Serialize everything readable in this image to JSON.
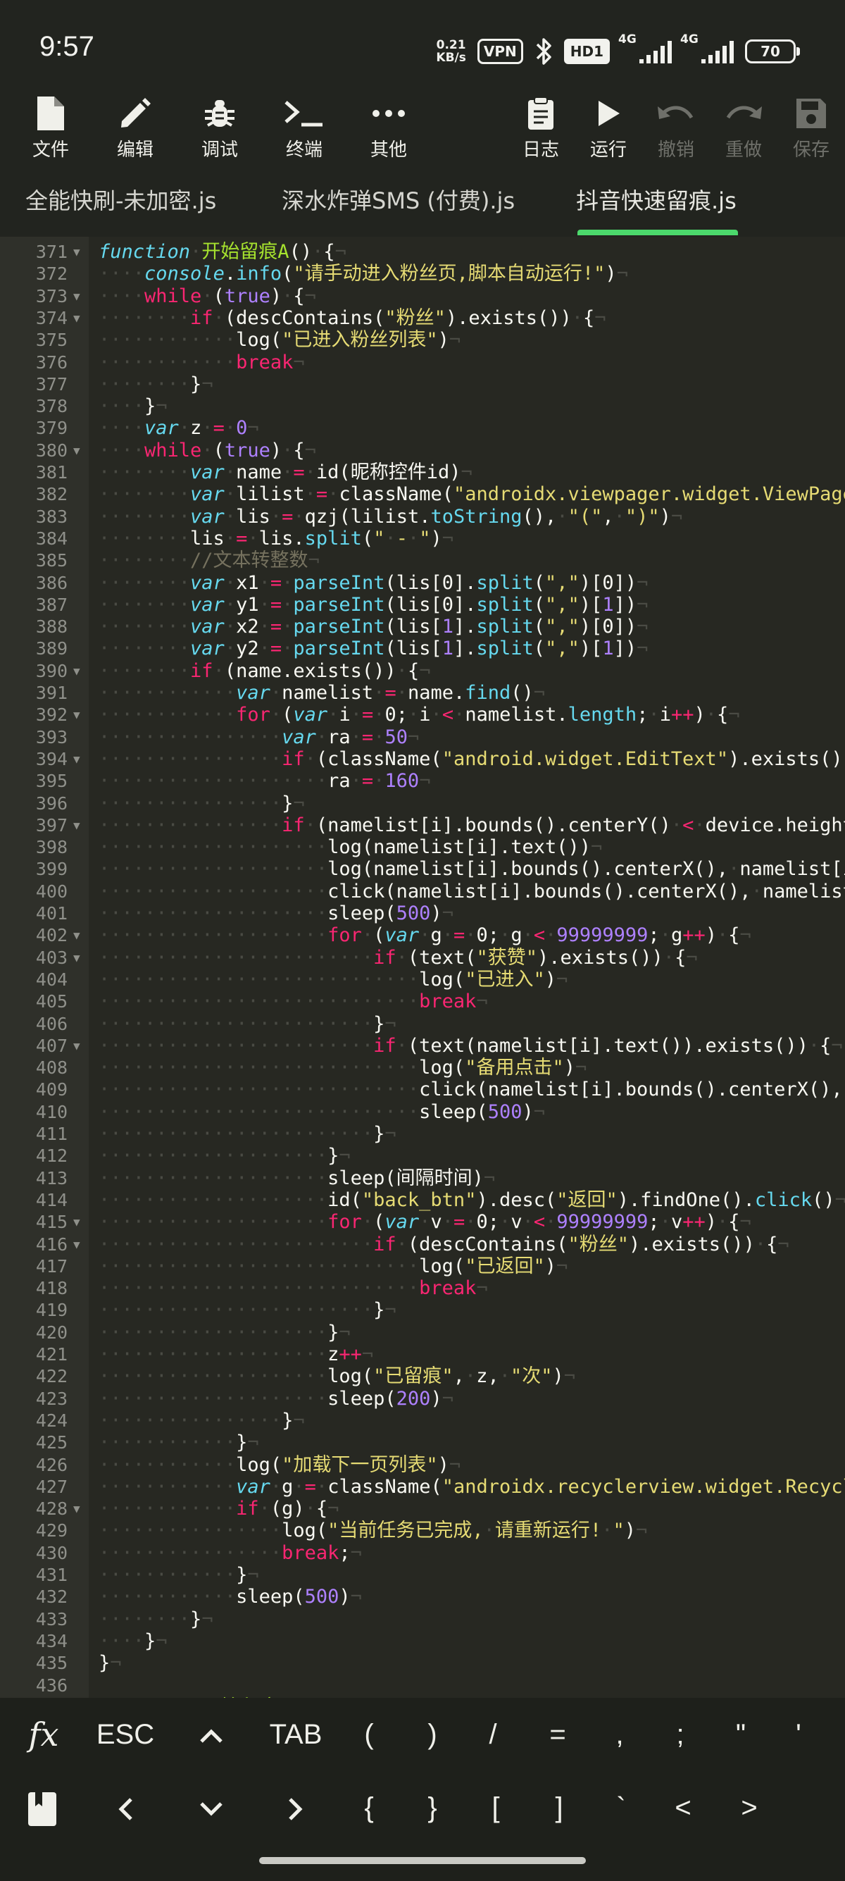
{
  "status": {
    "time": "9:57",
    "net_speed_value": "0.21",
    "net_speed_unit": "KB/s",
    "vpn": "VPN",
    "hd": "HD1",
    "net1": "4G",
    "net2": "4G",
    "battery": "70"
  },
  "toolbar": {
    "file": "文件",
    "edit": "编辑",
    "debug": "调试",
    "terminal": "终端",
    "more": "其他",
    "log": "日志",
    "run": "运行",
    "undo": "撤销",
    "redo": "重做",
    "save": "保存"
  },
  "tabs": [
    {
      "label": "全能快刷-未加密.js"
    },
    {
      "label": "深水炸弹SMS (付费).js"
    },
    {
      "label": "抖音快速留痕.js"
    }
  ],
  "code_lines": [
    {
      "n": "371",
      "fold": true,
      "i": 0,
      "t": [
        [
          "it",
          "function"
        ],
        [
          "p",
          " "
        ],
        [
          "fn",
          "开始留痕A"
        ],
        [
          "p",
          "() {"
        ]
      ]
    },
    {
      "n": "372",
      "i": 1,
      "t": [
        [
          "it",
          "console"
        ],
        [
          "p",
          "."
        ],
        [
          "bi",
          "info"
        ],
        [
          "p",
          "("
        ],
        [
          "st",
          "\"请手动进入粉丝页,脚本自动运行!\""
        ],
        [
          "p",
          ")"
        ]
      ]
    },
    {
      "n": "373",
      "fold": true,
      "i": 1,
      "t": [
        [
          "kw",
          "while"
        ],
        [
          "p",
          " ("
        ],
        [
          "nu",
          "true"
        ],
        [
          "p",
          ") {"
        ]
      ]
    },
    {
      "n": "374",
      "fold": true,
      "i": 2,
      "t": [
        [
          "kw",
          "if"
        ],
        [
          "p",
          " (descContains("
        ],
        [
          "st",
          "\"粉丝\""
        ],
        [
          "p",
          ").exists()) {"
        ]
      ]
    },
    {
      "n": "375",
      "i": 3,
      "t": [
        [
          "p",
          "log("
        ],
        [
          "st",
          "\"已进入粉丝列表\""
        ],
        [
          "p",
          ")"
        ]
      ]
    },
    {
      "n": "376",
      "i": 3,
      "t": [
        [
          "kw",
          "break"
        ]
      ]
    },
    {
      "n": "377",
      "i": 2,
      "t": [
        [
          "p",
          "}"
        ]
      ]
    },
    {
      "n": "378",
      "i": 1,
      "t": [
        [
          "p",
          "}"
        ]
      ]
    },
    {
      "n": "379",
      "i": 1,
      "t": [
        [
          "it",
          "var"
        ],
        [
          "p",
          " z "
        ],
        [
          "kw",
          "="
        ],
        [
          "p",
          " "
        ],
        [
          "nu",
          "0"
        ]
      ]
    },
    {
      "n": "380",
      "fold": true,
      "i": 1,
      "t": [
        [
          "kw",
          "while"
        ],
        [
          "p",
          " ("
        ],
        [
          "nu",
          "true"
        ],
        [
          "p",
          ") {"
        ]
      ]
    },
    {
      "n": "381",
      "i": 2,
      "t": [
        [
          "it",
          "var"
        ],
        [
          "p",
          " name "
        ],
        [
          "kw",
          "="
        ],
        [
          "p",
          " id(昵称控件id)"
        ]
      ]
    },
    {
      "n": "382",
      "i": 2,
      "t": [
        [
          "it",
          "var"
        ],
        [
          "p",
          " lilist "
        ],
        [
          "kw",
          "="
        ],
        [
          "p",
          " className("
        ],
        [
          "st",
          "\"androidx.viewpager.widget.ViewPager\""
        ],
        [
          "p",
          ")"
        ]
      ]
    },
    {
      "n": "383",
      "i": 2,
      "t": [
        [
          "it",
          "var"
        ],
        [
          "p",
          " lis "
        ],
        [
          "kw",
          "="
        ],
        [
          "p",
          " qzj(lilist."
        ],
        [
          "bi",
          "toString"
        ],
        [
          "p",
          "(), "
        ],
        [
          "st",
          "\"(\""
        ],
        [
          "p",
          ", "
        ],
        [
          "st",
          "\")\""
        ],
        [
          "p",
          ")"
        ]
      ]
    },
    {
      "n": "384",
      "i": 2,
      "t": [
        [
          "p",
          "lis "
        ],
        [
          "kw",
          "="
        ],
        [
          "p",
          " lis."
        ],
        [
          "bi",
          "split"
        ],
        [
          "p",
          "("
        ],
        [
          "st",
          "\" - \""
        ],
        [
          "p",
          ")"
        ]
      ]
    },
    {
      "n": "385",
      "i": 2,
      "t": [
        [
          "cm",
          "//文本转整数"
        ]
      ]
    },
    {
      "n": "386",
      "i": 2,
      "t": [
        [
          "it",
          "var"
        ],
        [
          "p",
          " x1 "
        ],
        [
          "kw",
          "="
        ],
        [
          "p",
          " "
        ],
        [
          "bi",
          "parseInt"
        ],
        [
          "p",
          "(lis[0]."
        ],
        [
          "bi",
          "split"
        ],
        [
          "p",
          "("
        ],
        [
          "st",
          "\",\""
        ],
        [
          "p",
          ")[0])"
        ]
      ]
    },
    {
      "n": "387",
      "i": 2,
      "t": [
        [
          "it",
          "var"
        ],
        [
          "p",
          " y1 "
        ],
        [
          "kw",
          "="
        ],
        [
          "p",
          " "
        ],
        [
          "bi",
          "parseInt"
        ],
        [
          "p",
          "(lis[0]."
        ],
        [
          "bi",
          "split"
        ],
        [
          "p",
          "("
        ],
        [
          "st",
          "\",\""
        ],
        [
          "p",
          ")["
        ],
        [
          "nu",
          "1"
        ],
        [
          "p",
          "])"
        ]
      ]
    },
    {
      "n": "388",
      "i": 2,
      "t": [
        [
          "it",
          "var"
        ],
        [
          "p",
          " x2 "
        ],
        [
          "kw",
          "="
        ],
        [
          "p",
          " "
        ],
        [
          "bi",
          "parseInt"
        ],
        [
          "p",
          "(lis["
        ],
        [
          "nu",
          "1"
        ],
        [
          "p",
          "]."
        ],
        [
          "bi",
          "split"
        ],
        [
          "p",
          "("
        ],
        [
          "st",
          "\",\""
        ],
        [
          "p",
          ")[0])"
        ]
      ]
    },
    {
      "n": "389",
      "i": 2,
      "t": [
        [
          "it",
          "var"
        ],
        [
          "p",
          " y2 "
        ],
        [
          "kw",
          "="
        ],
        [
          "p",
          " "
        ],
        [
          "bi",
          "parseInt"
        ],
        [
          "p",
          "(lis["
        ],
        [
          "nu",
          "1"
        ],
        [
          "p",
          "]."
        ],
        [
          "bi",
          "split"
        ],
        [
          "p",
          "("
        ],
        [
          "st",
          "\",\""
        ],
        [
          "p",
          ")["
        ],
        [
          "nu",
          "1"
        ],
        [
          "p",
          "])"
        ]
      ]
    },
    {
      "n": "390",
      "fold": true,
      "i": 2,
      "t": [
        [
          "kw",
          "if"
        ],
        [
          "p",
          " (name.exists()) {"
        ]
      ]
    },
    {
      "n": "391",
      "i": 3,
      "t": [
        [
          "it",
          "var"
        ],
        [
          "p",
          " namelist "
        ],
        [
          "kw",
          "="
        ],
        [
          "p",
          " name."
        ],
        [
          "bi",
          "find"
        ],
        [
          "p",
          "()"
        ]
      ]
    },
    {
      "n": "392",
      "fold": true,
      "i": 3,
      "t": [
        [
          "kw",
          "for"
        ],
        [
          "p",
          " ("
        ],
        [
          "it",
          "var"
        ],
        [
          "p",
          " i "
        ],
        [
          "kw",
          "="
        ],
        [
          "p",
          " 0; i "
        ],
        [
          "kw",
          "<"
        ],
        [
          "p",
          " namelist."
        ],
        [
          "bi",
          "length"
        ],
        [
          "p",
          "; i"
        ],
        [
          "kw",
          "++"
        ],
        [
          "p",
          ") {"
        ]
      ]
    },
    {
      "n": "393",
      "i": 4,
      "t": [
        [
          "it",
          "var"
        ],
        [
          "p",
          " ra "
        ],
        [
          "kw",
          "="
        ],
        [
          "p",
          " "
        ],
        [
          "nu",
          "50"
        ]
      ]
    },
    {
      "n": "394",
      "fold": true,
      "i": 4,
      "t": [
        [
          "kw",
          "if"
        ],
        [
          "p",
          " (className("
        ],
        [
          "st",
          "\"android.widget.EditText\""
        ],
        [
          "p",
          ").exists()) {"
        ]
      ]
    },
    {
      "n": "395",
      "i": 5,
      "t": [
        [
          "p",
          "ra "
        ],
        [
          "kw",
          "="
        ],
        [
          "p",
          " "
        ],
        [
          "nu",
          "160"
        ]
      ]
    },
    {
      "n": "396",
      "i": 4,
      "t": [
        [
          "p",
          "}"
        ]
      ]
    },
    {
      "n": "397",
      "fold": true,
      "i": 4,
      "t": [
        [
          "kw",
          "if"
        ],
        [
          "p",
          " (namelist[i].bounds().centerY() "
        ],
        [
          "kw",
          "<"
        ],
        [
          "p",
          " device.height"
        ]
      ]
    },
    {
      "n": "398",
      "i": 5,
      "t": [
        [
          "p",
          "log(namelist[i].text())"
        ]
      ]
    },
    {
      "n": "399",
      "i": 5,
      "t": [
        [
          "p",
          "log(namelist[i].bounds().centerX(), namelist[i]"
        ]
      ]
    },
    {
      "n": "400",
      "i": 5,
      "t": [
        [
          "p",
          "click(namelist[i].bounds().centerX(), namelist["
        ]
      ]
    },
    {
      "n": "401",
      "i": 5,
      "t": [
        [
          "p",
          "sleep("
        ],
        [
          "nu",
          "500"
        ],
        [
          "p",
          ")"
        ]
      ]
    },
    {
      "n": "402",
      "fold": true,
      "i": 5,
      "t": [
        [
          "kw",
          "for"
        ],
        [
          "p",
          " ("
        ],
        [
          "it",
          "var"
        ],
        [
          "p",
          " g "
        ],
        [
          "kw",
          "="
        ],
        [
          "p",
          " 0; g "
        ],
        [
          "kw",
          "<"
        ],
        [
          "p",
          " "
        ],
        [
          "nu",
          "99999999"
        ],
        [
          "p",
          "; g"
        ],
        [
          "kw",
          "++"
        ],
        [
          "p",
          ") {"
        ]
      ]
    },
    {
      "n": "403",
      "fold": true,
      "i": 6,
      "t": [
        [
          "kw",
          "if"
        ],
        [
          "p",
          " (text("
        ],
        [
          "st",
          "\"获赞\""
        ],
        [
          "p",
          ").exists()) {"
        ]
      ]
    },
    {
      "n": "404",
      "i": 7,
      "t": [
        [
          "p",
          "log("
        ],
        [
          "st",
          "\"已进入\""
        ],
        [
          "p",
          ")"
        ]
      ]
    },
    {
      "n": "405",
      "i": 7,
      "t": [
        [
          "kw",
          "break"
        ]
      ]
    },
    {
      "n": "406",
      "i": 6,
      "t": [
        [
          "p",
          "}"
        ]
      ]
    },
    {
      "n": "407",
      "fold": true,
      "i": 6,
      "t": [
        [
          "kw",
          "if"
        ],
        [
          "p",
          " (text(namelist[i].text()).exists()) {"
        ]
      ]
    },
    {
      "n": "408",
      "i": 7,
      "t": [
        [
          "p",
          "log("
        ],
        [
          "st",
          "\"备用点击\""
        ],
        [
          "p",
          ")"
        ]
      ]
    },
    {
      "n": "409",
      "i": 7,
      "t": [
        [
          "p",
          "click(namelist[i].bounds().centerX(), n"
        ]
      ]
    },
    {
      "n": "410",
      "i": 7,
      "t": [
        [
          "p",
          "sleep("
        ],
        [
          "nu",
          "500"
        ],
        [
          "p",
          ")"
        ]
      ]
    },
    {
      "n": "411",
      "i": 6,
      "t": [
        [
          "p",
          "}"
        ]
      ]
    },
    {
      "n": "412",
      "i": 5,
      "t": [
        [
          "p",
          "}"
        ]
      ]
    },
    {
      "n": "413",
      "i": 5,
      "t": [
        [
          "p",
          "sleep(间隔时间)"
        ]
      ]
    },
    {
      "n": "414",
      "i": 5,
      "t": [
        [
          "p",
          "id("
        ],
        [
          "st",
          "\"back_btn\""
        ],
        [
          "p",
          ").desc("
        ],
        [
          "st",
          "\"返回\""
        ],
        [
          "p",
          ").findOne()."
        ],
        [
          "bi",
          "click"
        ],
        [
          "p",
          "()"
        ]
      ]
    },
    {
      "n": "415",
      "fold": true,
      "i": 5,
      "t": [
        [
          "kw",
          "for"
        ],
        [
          "p",
          " ("
        ],
        [
          "it",
          "var"
        ],
        [
          "p",
          " v "
        ],
        [
          "kw",
          "="
        ],
        [
          "p",
          " 0; v "
        ],
        [
          "kw",
          "<"
        ],
        [
          "p",
          " "
        ],
        [
          "nu",
          "99999999"
        ],
        [
          "p",
          "; v"
        ],
        [
          "kw",
          "++"
        ],
        [
          "p",
          ") {"
        ]
      ]
    },
    {
      "n": "416",
      "fold": true,
      "i": 6,
      "t": [
        [
          "kw",
          "if"
        ],
        [
          "p",
          " (descContains("
        ],
        [
          "st",
          "\"粉丝\""
        ],
        [
          "p",
          ").exists()) {"
        ]
      ]
    },
    {
      "n": "417",
      "i": 7,
      "t": [
        [
          "p",
          "log("
        ],
        [
          "st",
          "\"已返回\""
        ],
        [
          "p",
          ")"
        ]
      ]
    },
    {
      "n": "418",
      "i": 7,
      "t": [
        [
          "kw",
          "break"
        ]
      ]
    },
    {
      "n": "419",
      "i": 6,
      "t": [
        [
          "p",
          "}"
        ]
      ]
    },
    {
      "n": "420",
      "i": 5,
      "t": [
        [
          "p",
          "}"
        ]
      ]
    },
    {
      "n": "421",
      "i": 5,
      "t": [
        [
          "p",
          "z"
        ],
        [
          "kw",
          "++"
        ]
      ]
    },
    {
      "n": "422",
      "i": 5,
      "t": [
        [
          "p",
          "log("
        ],
        [
          "st",
          "\"已留痕\""
        ],
        [
          "p",
          ", z, "
        ],
        [
          "st",
          "\"次\""
        ],
        [
          "p",
          ")"
        ]
      ]
    },
    {
      "n": "423",
      "i": 5,
      "t": [
        [
          "p",
          "sleep("
        ],
        [
          "nu",
          "200"
        ],
        [
          "p",
          ")"
        ]
      ]
    },
    {
      "n": "424",
      "i": 4,
      "t": [
        [
          "p",
          "}"
        ]
      ]
    },
    {
      "n": "425",
      "i": 3,
      "t": [
        [
          "p",
          "}"
        ]
      ]
    },
    {
      "n": "426",
      "i": 3,
      "t": [
        [
          "p",
          "log("
        ],
        [
          "st",
          "\"加载下一页列表\""
        ],
        [
          "p",
          ")"
        ]
      ]
    },
    {
      "n": "427",
      "i": 3,
      "t": [
        [
          "it",
          "var"
        ],
        [
          "p",
          " g "
        ],
        [
          "kw",
          "="
        ],
        [
          "p",
          " className("
        ],
        [
          "st",
          "\"androidx.recyclerview.widget.RecyclerView\""
        ],
        [
          "p",
          ")"
        ]
      ]
    },
    {
      "n": "428",
      "fold": true,
      "i": 3,
      "t": [
        [
          "kw",
          "if"
        ],
        [
          "p",
          " (g) {"
        ]
      ]
    },
    {
      "n": "429",
      "i": 4,
      "t": [
        [
          "p",
          "log("
        ],
        [
          "st",
          "\"当前任务已完成, 请重新运行! \""
        ],
        [
          "p",
          ")"
        ]
      ]
    },
    {
      "n": "430",
      "i": 4,
      "t": [
        [
          "kw",
          "break"
        ],
        [
          "p",
          ";"
        ]
      ]
    },
    {
      "n": "431",
      "i": 3,
      "t": [
        [
          "p",
          "}"
        ]
      ]
    },
    {
      "n": "432",
      "i": 3,
      "t": [
        [
          "p",
          "sleep("
        ],
        [
          "nu",
          "500"
        ],
        [
          "p",
          ")"
        ]
      ]
    },
    {
      "n": "433",
      "i": 2,
      "t": [
        [
          "p",
          "}"
        ]
      ]
    },
    {
      "n": "434",
      "i": 1,
      "t": [
        [
          "p",
          "}"
        ]
      ]
    },
    {
      "n": "435",
      "i": 0,
      "t": [
        [
          "p",
          "}"
        ]
      ]
    },
    {
      "n": "436",
      "i": 0,
      "t": []
    },
    {
      "n": "437",
      "fold": true,
      "i": 0,
      "t": [
        [
          "it",
          "function"
        ],
        [
          "p",
          " "
        ],
        [
          "fn",
          "开始留痕B"
        ],
        [
          "p",
          "() {"
        ]
      ]
    }
  ],
  "keys_row1": [
    "fx",
    "ESC",
    "^",
    "TAB",
    "(",
    ")",
    "/",
    "=",
    ",",
    ";",
    "\"",
    "'"
  ],
  "keys_row2": [
    "bookmark",
    "<",
    "v",
    ">",
    "{",
    "}",
    "[",
    "]",
    "`",
    "<",
    ">"
  ]
}
